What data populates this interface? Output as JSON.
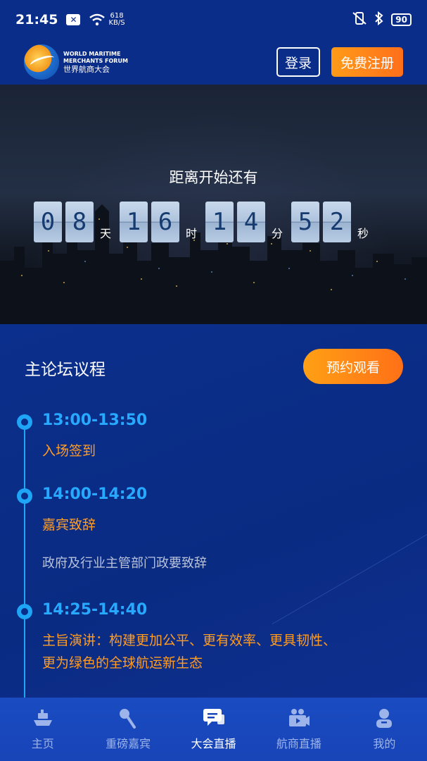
{
  "status_bar": {
    "time": "21:45",
    "network_speed_value": "618",
    "network_speed_unit": "KB/S",
    "battery": "90"
  },
  "header": {
    "logo_en_line1": "WORLD MARITIME",
    "logo_en_line2": "MERCHANTS FORUM",
    "logo_cn": "世界航商大会",
    "login_label": "登录",
    "register_label": "免费注册"
  },
  "countdown": {
    "title": "距离开始还有",
    "days": [
      "0",
      "8"
    ],
    "days_unit": "天",
    "hours": [
      "1",
      "6"
    ],
    "hours_unit": "时",
    "minutes": [
      "1",
      "4"
    ],
    "minutes_unit": "分",
    "seconds": [
      "5",
      "2"
    ],
    "seconds_unit": "秒"
  },
  "agenda": {
    "title": "主论坛议程",
    "reserve_label": "预约观看",
    "items": [
      {
        "time": "13:00-13:50",
        "title": "入场签到",
        "desc": ""
      },
      {
        "time": "14:00-14:20",
        "title": "嘉宾致辞",
        "desc": "政府及行业主管部门政要致辞"
      },
      {
        "time": "14:25-14:40",
        "title_line1": "主旨演讲：构建更加公平、更有效率、更具韧性、",
        "title_line2": "更为绿色的全球航运新生态",
        "desc": ""
      }
    ]
  },
  "bottom_nav": {
    "items": [
      {
        "label": "主页",
        "icon": "ship-icon",
        "active": false
      },
      {
        "label": "重磅嘉宾",
        "icon": "microphone-icon",
        "active": false
      },
      {
        "label": "大会直播",
        "icon": "chat-icon",
        "active": true
      },
      {
        "label": "航商直播",
        "icon": "video-camera-icon",
        "active": false
      },
      {
        "label": "我的",
        "icon": "user-icon",
        "active": false
      }
    ]
  },
  "colors": {
    "accent_orange": "#ff8a1a",
    "timeline_blue": "#27a9ff",
    "background_blue": "#0a2f86"
  }
}
